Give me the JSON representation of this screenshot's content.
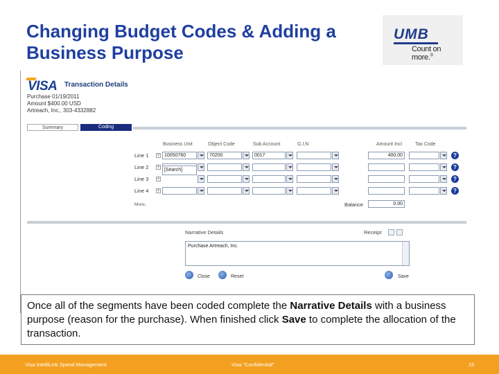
{
  "slide": {
    "title_line1": "Changing Budget Codes & Adding a",
    "title_line2": "Business Purpose"
  },
  "logo": {
    "mark": "UMB",
    "tagline": "Count on more.",
    "tagline_mark": "®"
  },
  "app": {
    "brand": "VISA",
    "window_title": "Transaction Details",
    "purchase_date": "Purchase 01/19/2011",
    "amount": "Amount $400.00 USD",
    "merchant": "Artreach, Inc., 303-4332882",
    "tabs": [
      {
        "label": "Summary",
        "active": false
      },
      {
        "label": "Coding",
        "active": true
      }
    ],
    "columns": [
      "Business Unit",
      "Object Code",
      "Sub Account",
      "G.I.N",
      "Amount Incl",
      "Tax Code"
    ],
    "lines": [
      {
        "label": "Line 1",
        "business_unit": "10050760",
        "object_code": "70200",
        "sub_account": "0017",
        "gin": "",
        "amount": "400.00",
        "tax_code": ""
      },
      {
        "label": "Line 2",
        "business_unit": "",
        "object_code": "",
        "sub_account": "",
        "gin": "",
        "amount": "",
        "tax_code": ""
      },
      {
        "label": "Line 3",
        "business_unit": "",
        "object_code": "",
        "sub_account": "",
        "gin": "",
        "amount": "",
        "tax_code": ""
      },
      {
        "label": "Line 4",
        "business_unit": "",
        "object_code": "",
        "sub_account": "",
        "gin": "",
        "amount": "",
        "tax_code": ""
      }
    ],
    "search_popup": "[Search]",
    "more_link": "More..",
    "balance_label": "Balance",
    "balance_value": "0.00",
    "narrative_label": "Narrative Details",
    "narrative_text": "Purchase Artreach, Inc.",
    "receipt_label": "Receipt",
    "close_label": "Close",
    "reset_label": "Reset",
    "save_label": "Save"
  },
  "callout": {
    "part1": "Once all of the segments have been coded complete the ",
    "bold1": "Narrative Details",
    "part2": " with a business purpose (reason for the purchase). When finished click ",
    "bold2": "Save",
    "part3": " to complete the allocation of the transaction."
  },
  "footer": {
    "left": "Visa IntelliLink Spend Management",
    "center": "Visa \"Confidential\"",
    "page": "15"
  },
  "colors": {
    "title": "#1f3fa0",
    "footer": "#f3a020",
    "visa_blue": "#1b2c7e"
  }
}
